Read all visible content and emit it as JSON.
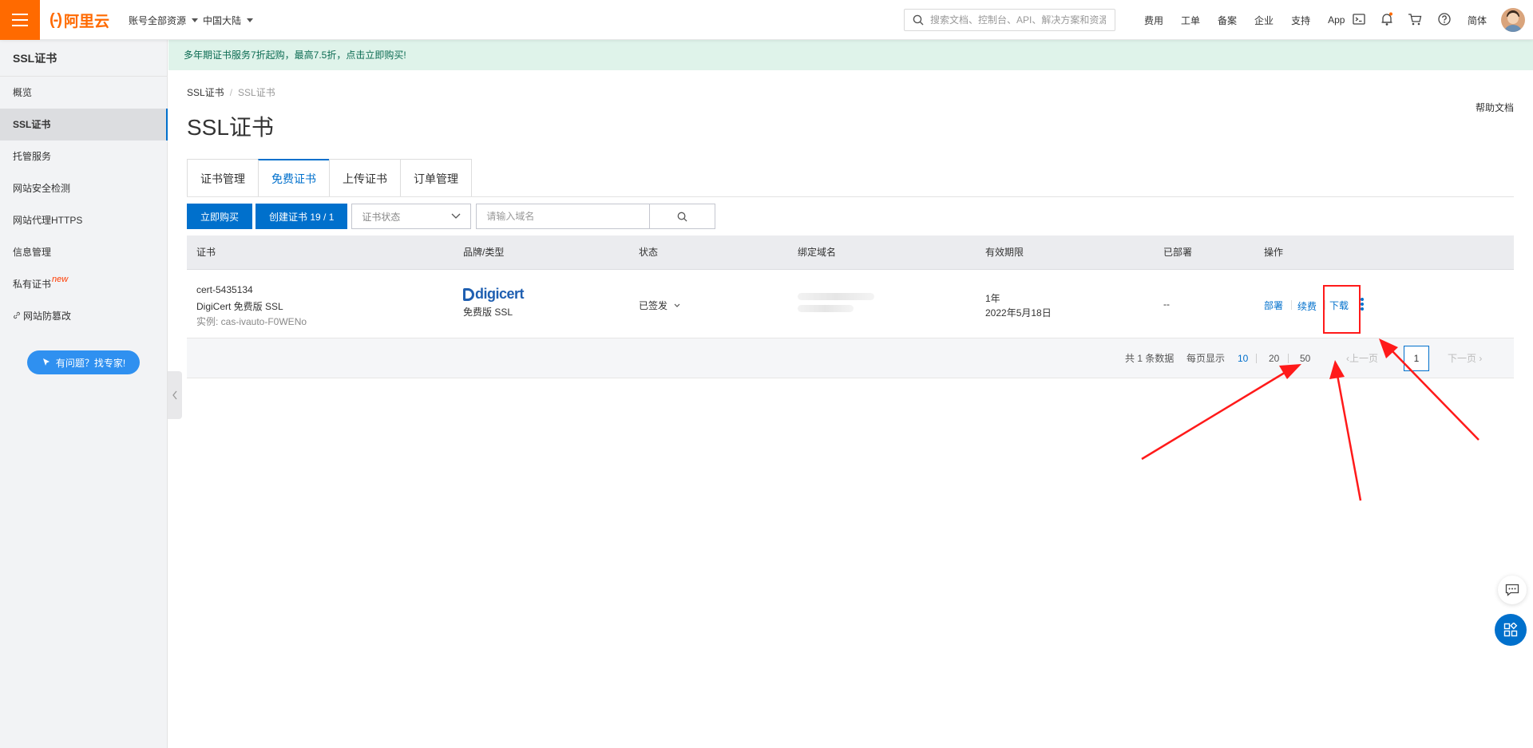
{
  "topbar": {
    "logo_text": "阿里云",
    "account_scope": "账号全部资源",
    "region": "中国大陆",
    "search_placeholder": "搜索文档、控制台、API、解决方案和资源",
    "links": [
      "费用",
      "工单",
      "备案",
      "企业",
      "支持",
      "App"
    ],
    "language": "简体",
    "icons": [
      "terminal-icon",
      "bell-icon",
      "cart-icon",
      "help-icon"
    ]
  },
  "sidebar": {
    "title": "SSL证书",
    "items": [
      {
        "label": "概览"
      },
      {
        "label": "SSL证书",
        "active": true
      },
      {
        "label": "托管服务"
      },
      {
        "label": "网站安全检测"
      },
      {
        "label": "网站代理HTTPS"
      },
      {
        "label": "信息管理"
      },
      {
        "label": "私有证书",
        "badge": "new"
      },
      {
        "label": "网站防篡改"
      }
    ],
    "expert_button": "有问题？找专家!"
  },
  "banner": {
    "text": "多年期证书服务7折起购，最高7.5折，点击立即购买!"
  },
  "breadcrumb": [
    "SSL证书",
    "SSL证书"
  ],
  "help_doc": "帮助文档",
  "page_title": "SSL证书",
  "tabs": [
    {
      "label": "证书管理"
    },
    {
      "label": "免费证书",
      "active": true
    },
    {
      "label": "上传证书"
    },
    {
      "label": "订单管理"
    }
  ],
  "toolbar": {
    "buy_now": "立即购买",
    "create_cert": "创建证书 19 / 1",
    "status_select": "证书状态",
    "domain_placeholder": "请输入域名"
  },
  "table": {
    "headers": [
      "证书",
      "品牌/类型",
      "状态",
      "绑定域名",
      "有效期限",
      "已部署",
      "操作"
    ],
    "rows": [
      {
        "cert_name": "cert-5435134",
        "cert_type": "DigiCert 免费版 SSL",
        "instance": "实例: cas-ivauto-F0WENo",
        "brand_logo": "digicert",
        "brand_type": "免费版 SSL",
        "status": "已签发",
        "validity_term": "1年",
        "validity_date": "2022年5月18日",
        "deployed": "--",
        "actions": [
          "部署",
          "续费",
          "下载"
        ]
      }
    ]
  },
  "pagination": {
    "total": "共 1 条数据",
    "per_page_label": "每页显示",
    "sizes": [
      "10",
      "20",
      "50"
    ],
    "selected_size": "10",
    "prev": "上一页",
    "current_page": "1",
    "next": "下一页"
  },
  "colors": {
    "brand_orange": "#ff6a00",
    "primary_blue": "#0070cc",
    "annotation_red": "#ff1a1a",
    "banner_bg": "#dff3ea"
  }
}
